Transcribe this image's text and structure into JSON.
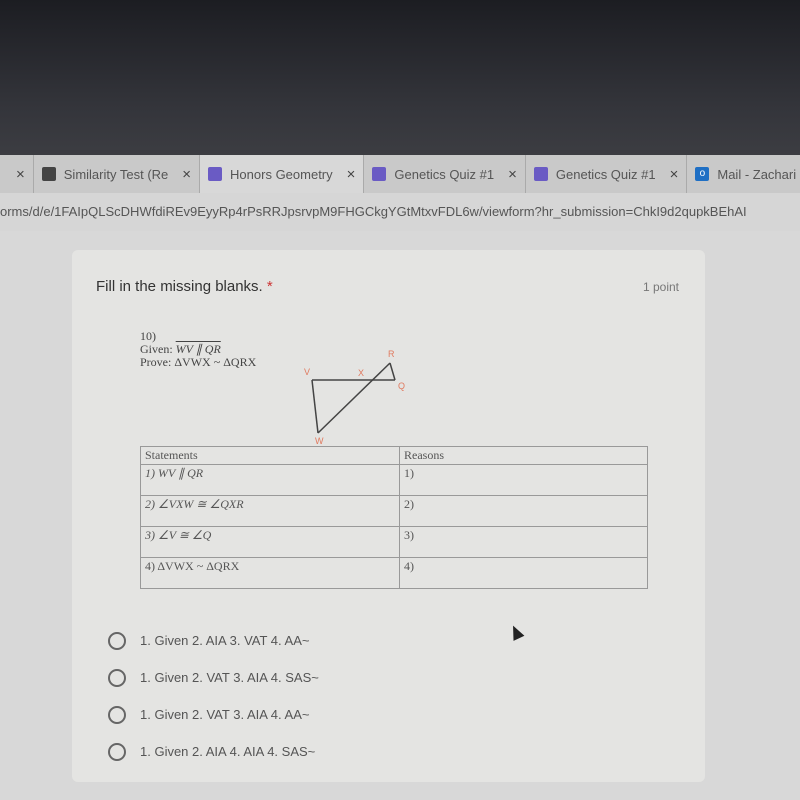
{
  "browser": {
    "tabs": [
      {
        "title": "",
        "icon": "tab-icon"
      },
      {
        "title": "Similarity Test (Re",
        "icon": "classroom-icon"
      },
      {
        "title": "Honors Geometry",
        "icon": "forms-icon"
      },
      {
        "title": "Genetics Quiz #1",
        "icon": "forms-icon"
      },
      {
        "title": "Genetics Quiz #1",
        "icon": "forms-icon"
      },
      {
        "title": "Mail - Zachari",
        "icon": "outlook-icon"
      }
    ],
    "close_glyph": "×",
    "url": "orms/d/e/1FAIpQLScDHWfdiREv9EyyRp4rPsRRJpsrvpM9FHGCkgYGtMtxvFDL6w/viewform?hr_submission=ChkI9d2qupkBEhAI"
  },
  "question": {
    "title": "Fill in the missing blanks.",
    "required": "*",
    "points": "1 point",
    "number": "10)",
    "given_label": "Given:",
    "given": "WV ∥ QR",
    "prove_label": "Prove:",
    "prove": "ΔVWX ~ ΔQRX",
    "diagram_labels": {
      "V": "V",
      "X": "X",
      "R": "R",
      "Q": "Q",
      "W": "W"
    },
    "table": {
      "headers": [
        "Statements",
        "Reasons"
      ],
      "rows": [
        [
          "1) WV ∥ QR",
          "1)"
        ],
        [
          "2) ∠VXW ≅ ∠QXR",
          "2)"
        ],
        [
          "3) ∠V ≅ ∠Q",
          "3)"
        ],
        [
          "4) ΔVWX ~ ΔQRX",
          "4)"
        ]
      ]
    },
    "options": [
      "1. Given 2. AIA 3. VAT 4. AA~",
      "1. Given 2. VAT 3. AIA 4. SAS~",
      "1. Given 2. VAT 3. AIA 4. AA~",
      "1. Given 2. AIA 4. AIA 4. SAS~"
    ]
  }
}
